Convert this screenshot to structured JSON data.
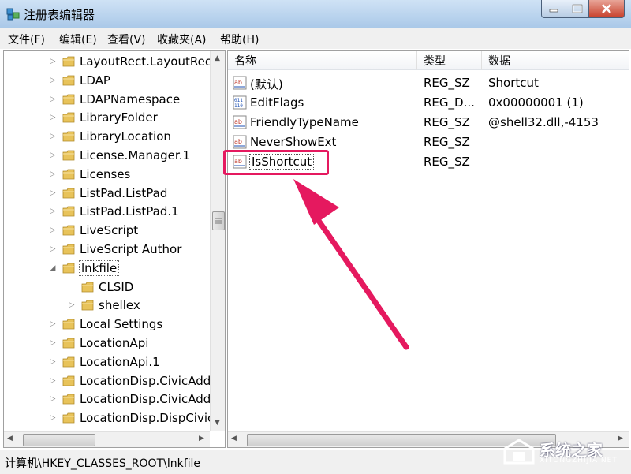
{
  "window": {
    "title": "注册表编辑器"
  },
  "menu": [
    "文件(F)",
    "编辑(E)",
    "查看(V)",
    "收藏夹(A)",
    "帮助(H)"
  ],
  "tree": [
    {
      "label": "LayoutRect.LayoutRect",
      "level": 1,
      "expander": "▷",
      "selected": false
    },
    {
      "label": "LDAP",
      "level": 1,
      "expander": "▷",
      "selected": false
    },
    {
      "label": "LDAPNamespace",
      "level": 1,
      "expander": "▷",
      "selected": false
    },
    {
      "label": "LibraryFolder",
      "level": 1,
      "expander": "▷",
      "selected": false
    },
    {
      "label": "LibraryLocation",
      "level": 1,
      "expander": "▷",
      "selected": false
    },
    {
      "label": "License.Manager.1",
      "level": 1,
      "expander": "▷",
      "selected": false
    },
    {
      "label": "Licenses",
      "level": 1,
      "expander": "▷",
      "selected": false
    },
    {
      "label": "ListPad.ListPad",
      "level": 1,
      "expander": "▷",
      "selected": false
    },
    {
      "label": "ListPad.ListPad.1",
      "level": 1,
      "expander": "▷",
      "selected": false
    },
    {
      "label": "LiveScript",
      "level": 1,
      "expander": "▷",
      "selected": false
    },
    {
      "label": "LiveScript Author",
      "level": 1,
      "expander": "▷",
      "selected": false
    },
    {
      "label": "lnkfile",
      "level": 1,
      "expander": "◢",
      "selected": true
    },
    {
      "label": "CLSID",
      "level": 2,
      "expander": "",
      "selected": false
    },
    {
      "label": "shellex",
      "level": 2,
      "expander": "▷",
      "selected": false
    },
    {
      "label": "Local Settings",
      "level": 1,
      "expander": "▷",
      "selected": false
    },
    {
      "label": "LocationApi",
      "level": 1,
      "expander": "▷",
      "selected": false
    },
    {
      "label": "LocationApi.1",
      "level": 1,
      "expander": "▷",
      "selected": false
    },
    {
      "label": "LocationDisp.CivicAddr",
      "level": 1,
      "expander": "▷",
      "selected": false
    },
    {
      "label": "LocationDisp.CivicAddr",
      "level": 1,
      "expander": "▷",
      "selected": false
    },
    {
      "label": "LocationDisp.DispCivic",
      "level": 1,
      "expander": "▷",
      "selected": false
    }
  ],
  "columns": [
    "名称",
    "类型",
    "数据"
  ],
  "values": [
    {
      "name": "(默认)",
      "type": "REG_SZ",
      "data": "Shortcut",
      "icon": "string-value-icon"
    },
    {
      "name": "EditFlags",
      "type": "REG_D...",
      "data": "0x00000001 (1)",
      "icon": "binary-value-icon"
    },
    {
      "name": "FriendlyTypeName",
      "type": "REG_SZ",
      "data": "@shell32.dll,-4153",
      "icon": "string-value-icon"
    },
    {
      "name": "NeverShowExt",
      "type": "REG_SZ",
      "data": "",
      "icon": "string-value-icon"
    },
    {
      "name": "IsShortcut",
      "type": "REG_SZ",
      "data": "",
      "icon": "string-value-icon"
    }
  ],
  "status": {
    "path": "计算机\\HKEY_CLASSES_ROOT\\lnkfile"
  },
  "watermark": {
    "text": "系统之家",
    "sub": "XITONGZHIJIA.NET"
  },
  "colors": {
    "highlight": "#e5195f",
    "titlebar": "#a9c8e8",
    "folder": "#e8c35a"
  }
}
